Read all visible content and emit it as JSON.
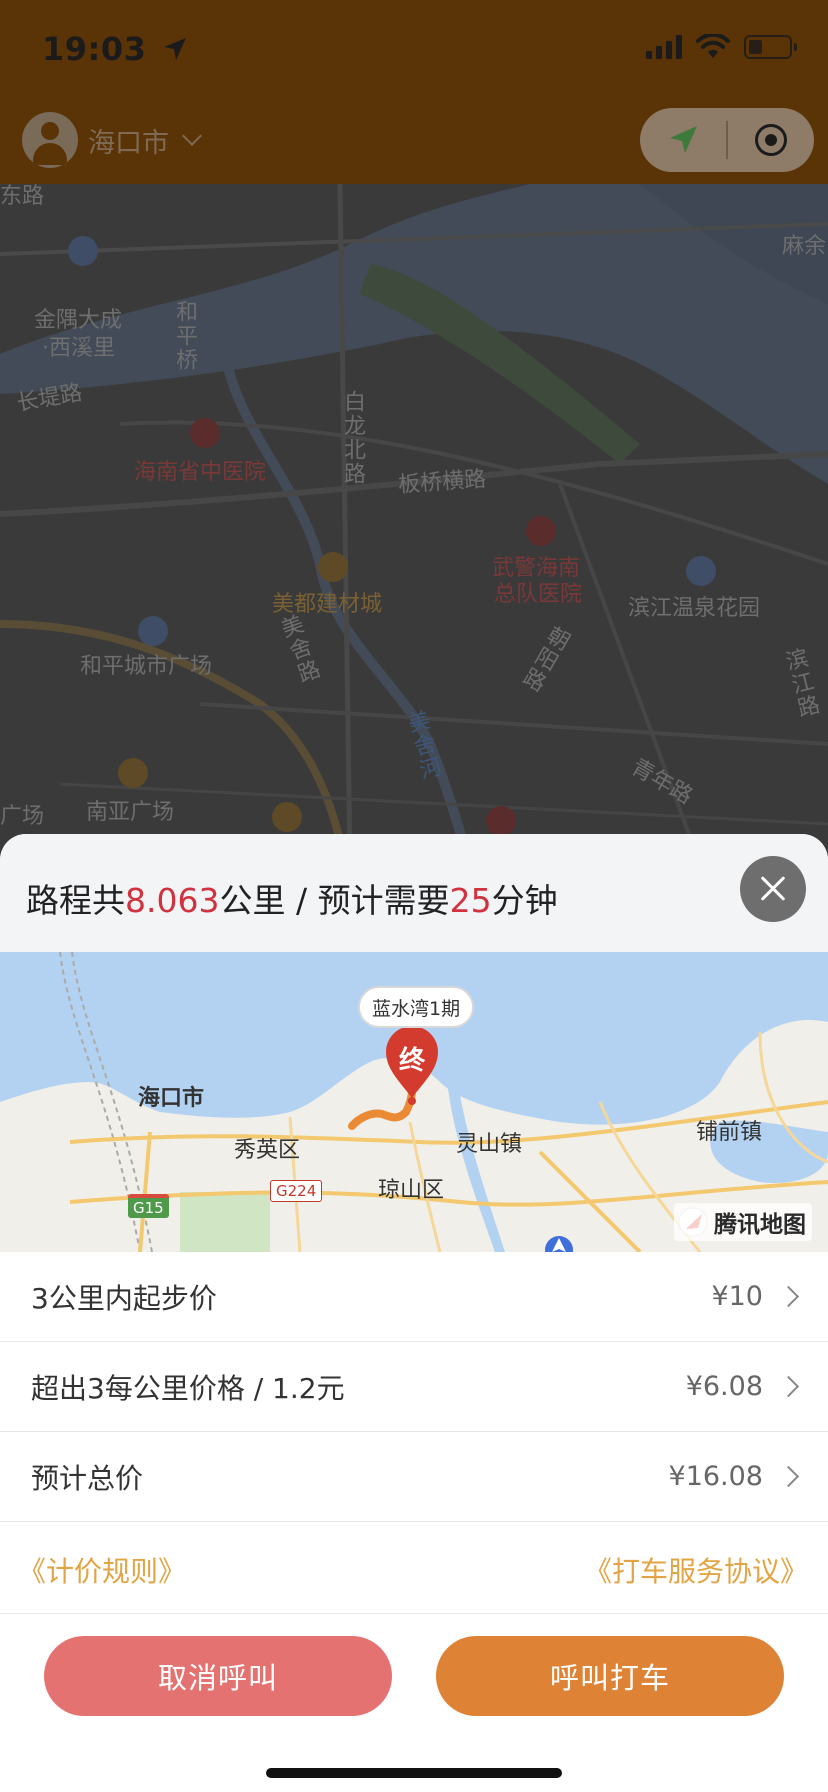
{
  "status_bar": {
    "time": "19:03",
    "icons": [
      "location-arrow-icon",
      "signal-icon",
      "wifi-icon",
      "battery-icon"
    ]
  },
  "header": {
    "city": "海口市",
    "avatar_icon": "user-avatar-icon",
    "locate_icon": "navigation-arrow-icon",
    "record_icon": "record-target-icon",
    "colors": {
      "bar": "#5a3407"
    }
  },
  "background_map": {
    "labels": [
      "东路",
      "麻余",
      "金隅大成",
      "·西溪里",
      "和平桥",
      "长堤路",
      "白龙北路",
      "海南省中医院",
      "板桥横路",
      "武警海南",
      "总队医院",
      "美都建材城",
      "滨江温泉花园",
      "和平城市广场",
      "美舍路",
      "朝阳路",
      "滨江路",
      "美舍河",
      "青年路",
      "南亚广场",
      "广场"
    ]
  },
  "route": {
    "prefix": "路程共",
    "distance": "8.063",
    "distance_unit": "公里",
    "separator": " / ",
    "time_prefix": "预计需要",
    "duration": "25",
    "duration_unit": "分钟",
    "colors": {
      "highlight": "#d0333f"
    }
  },
  "route_map": {
    "destination_name": "蓝水湾1期",
    "destination_marker": "终",
    "labels": {
      "haikou": "海口市",
      "xiuying": "秀英区",
      "qiongshan": "琼山区",
      "lingshan": "灵山镇",
      "puqian": "铺前镇"
    },
    "road_badges": [
      "G15",
      "G224"
    ],
    "provider": "腾讯地图"
  },
  "fare_rows": [
    {
      "label": "3公里内起步价",
      "value": "¥10"
    },
    {
      "label": "超出3每公里价格 / 1.2元",
      "value": "¥6.08"
    },
    {
      "label": "预计总价",
      "value": "¥16.08"
    }
  ],
  "links": {
    "pricing_rules": "《计价规则》",
    "service_agreement": "《打车服务协议》"
  },
  "buttons": {
    "cancel": "取消呼叫",
    "call": "呼叫打车",
    "colors": {
      "cancel": "#e37270",
      "call": "#de8235"
    }
  }
}
